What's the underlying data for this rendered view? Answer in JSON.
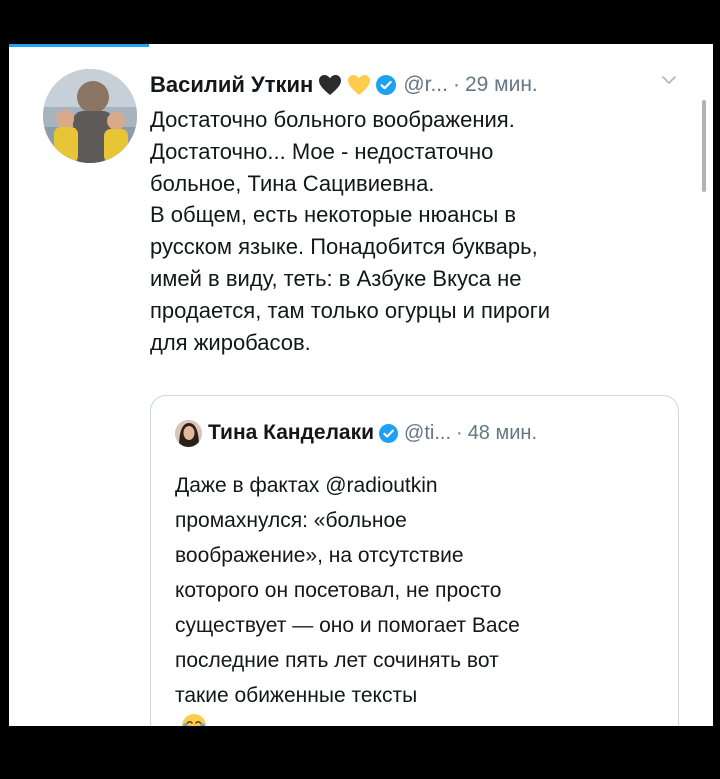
{
  "tweet": {
    "author_name": "Василий Уткин",
    "emojis": [
      "black-heart",
      "yellow-heart"
    ],
    "handle": "@r...",
    "separator": "·",
    "time": "29 мин.",
    "text_lines": [
      "Достаточно больного воображения.",
      "Достаточно... Мое - недостаточно",
      "больное, Тина Сацивиевна.",
      "В общем, есть некоторые нюансы в",
      "русском языке. Понадобится букварь,",
      "имей в виду, теть: в Азбуке Вкуса не",
      "продается, там только огурцы и пироги",
      "для жиробасов."
    ]
  },
  "quoted_tweet": {
    "author_name": "Тина Канделаки",
    "handle": "@ti...",
    "separator": "·",
    "time": "48 мин.",
    "text_lines": [
      "Даже в фактах @radioutkin",
      "промахнулся: «больное",
      "воображение», на отсутствие",
      "которого он посетовал, не просто",
      "существует — оно и помогает Васе",
      "последние пять лет сочинять вот",
      "такие обиженные тексты"
    ],
    "trailing_emoji": "face-with-tears-of-joy"
  },
  "icons": {
    "verified": "verified-badge-icon",
    "chevron": "chevron-down-icon"
  },
  "colors": {
    "text": "#14171a",
    "secondary_text": "#657786",
    "verified_blue": "#1da1f2",
    "card_border": "#ccd6dd",
    "frame": "#000000",
    "background": "#ffffff"
  }
}
